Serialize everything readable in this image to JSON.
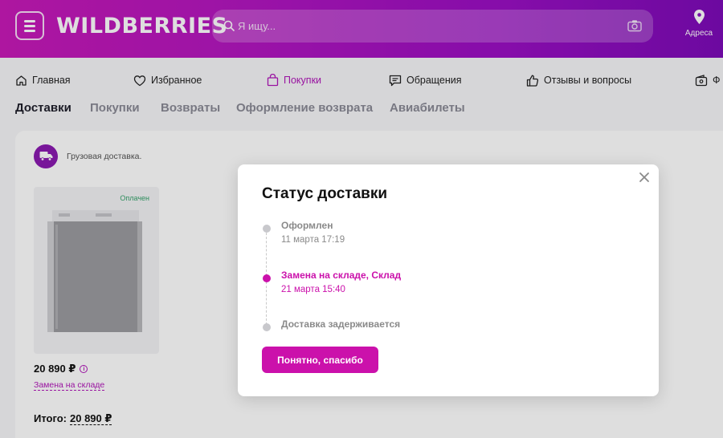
{
  "header": {
    "logo": "WILDBERRIES",
    "search_placeholder": "Я ищу...",
    "address_label": "Адреса"
  },
  "nav": {
    "items": [
      {
        "label": "Главная",
        "icon": "home-icon"
      },
      {
        "label": "Избранное",
        "icon": "heart-icon"
      },
      {
        "label": "Покупки",
        "icon": "bag-icon",
        "active": true
      },
      {
        "label": "Обращения",
        "icon": "chat-icon"
      },
      {
        "label": "Отзывы и вопросы",
        "icon": "thumbs-up-icon"
      },
      {
        "label": "Ф",
        "icon": "wallet-icon"
      }
    ]
  },
  "tabs": [
    {
      "label": "Доставки",
      "active": true
    },
    {
      "label": "Покупки"
    },
    {
      "label": "Возвраты"
    },
    {
      "label": "Оформление возврата"
    },
    {
      "label": "Авиабилеты"
    }
  ],
  "delivery_card": {
    "type_label": "Грузовая доставка.",
    "paid_badge": "Оплачен",
    "price": "20 890 ₽",
    "status_link": "Замена на складе",
    "total_label": "Итого:",
    "total_amount": "20 890 ₽"
  },
  "modal": {
    "title": "Статус доставки",
    "steps": [
      {
        "title": "Оформлен",
        "date": "11 марта 17:19",
        "active": false
      },
      {
        "title": "Замена на складе, Склад",
        "date": "21 марта 15:40",
        "active": true
      },
      {
        "title": "Доставка задерживается",
        "date": "",
        "active": false
      }
    ],
    "button_label": "Понятно, спасибо"
  },
  "colors": {
    "accent": "#cb11ab",
    "header_start": "#c81ab8",
    "header_end": "#7d0bb8",
    "paid": "#36a36c"
  }
}
